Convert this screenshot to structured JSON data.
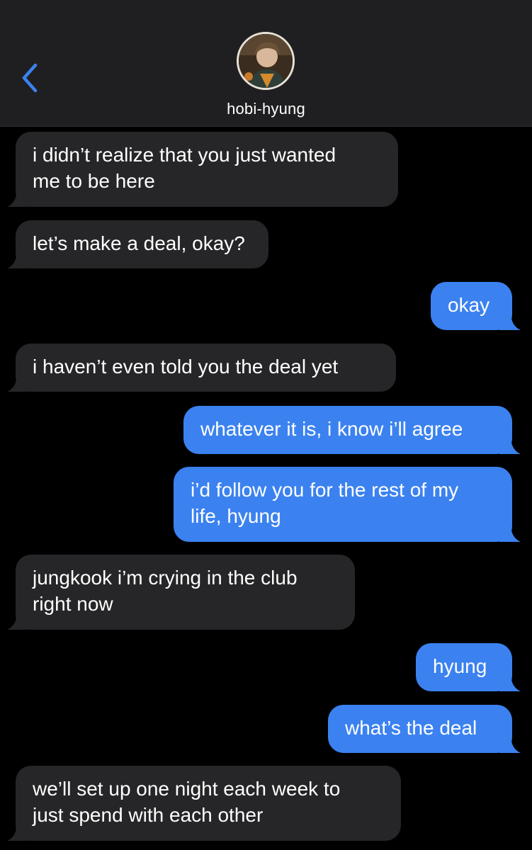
{
  "header": {
    "contact_name": "hobi-hyung",
    "back_icon": "chevron-left-icon",
    "accent_color": "#3b82f0"
  },
  "messages": [
    {
      "direction": "incoming",
      "text": "i didn’t realize that you just wanted\nme to be here"
    },
    {
      "direction": "incoming",
      "text": "let’s make a deal, okay?"
    },
    {
      "direction": "outgoing",
      "text": "okay"
    },
    {
      "direction": "incoming",
      "text": "i haven’t even told you the deal yet"
    },
    {
      "direction": "outgoing",
      "text": "whatever it is, i know i’ll agree"
    },
    {
      "direction": "outgoing",
      "text": "i’d follow you for the rest of my\nlife, hyung"
    },
    {
      "direction": "incoming",
      "text": "jungkook i’m crying in the club\nright now"
    },
    {
      "direction": "outgoing",
      "text": "hyung"
    },
    {
      "direction": "outgoing",
      "text": "what’s the deal"
    },
    {
      "direction": "incoming",
      "text": "we’ll set up one night each week to\njust spend with each other"
    }
  ],
  "colors": {
    "incoming_bubble": "#262628",
    "outgoing_bubble": "#3b82f0",
    "header_bg": "#1f1f21",
    "background": "#000000"
  }
}
